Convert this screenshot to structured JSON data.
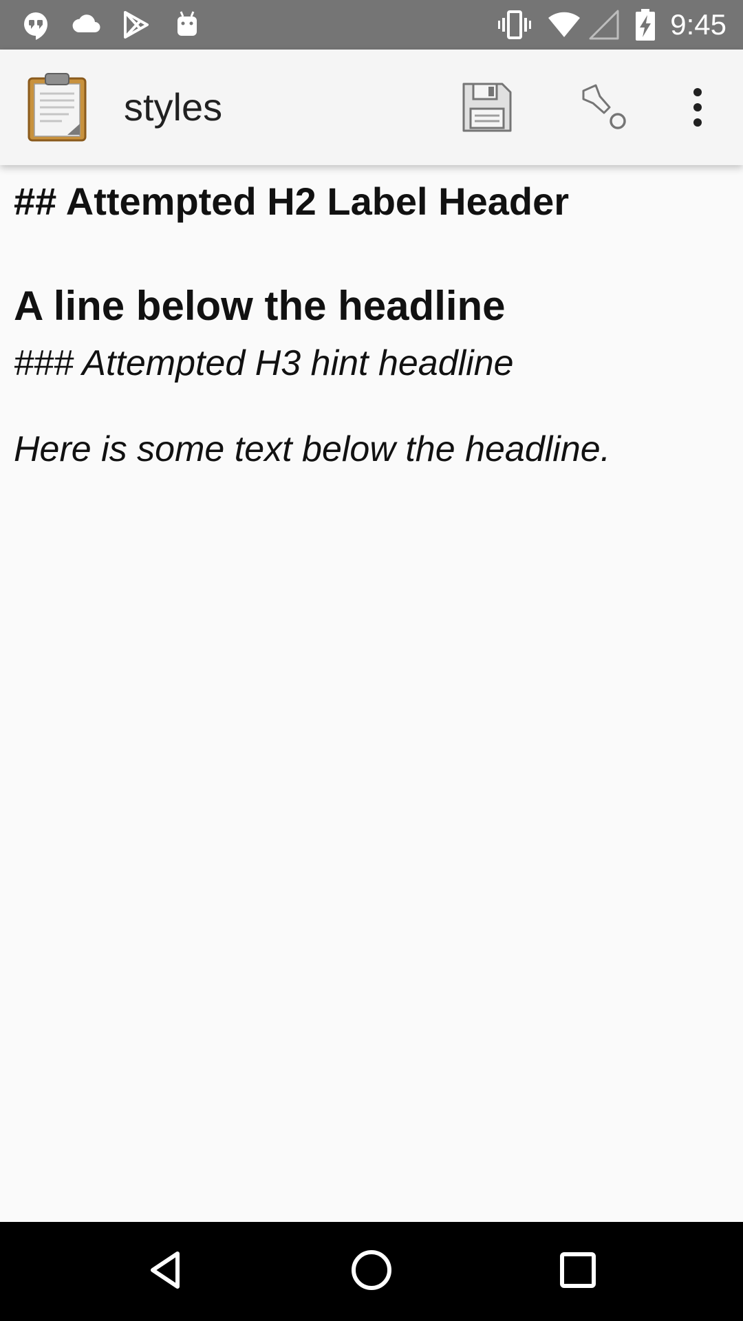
{
  "status_bar": {
    "time": "9:45",
    "left_icons": [
      "hangouts-icon",
      "cloud-icon",
      "play-store-icon",
      "android-icon"
    ],
    "right_icons": [
      "vibrate-icon",
      "wifi-icon",
      "cell-signal-icon",
      "battery-charging-icon"
    ],
    "background": "#757575"
  },
  "app_bar": {
    "title": "styles",
    "app_icon": "clipboard-icon",
    "actions": [
      "save-icon",
      "go-to-icon",
      "overflow-menu-icon"
    ],
    "background": "#f5f5f5"
  },
  "content": {
    "h2_raw": "## Attempted H2 Label Header",
    "label_line": "A line below the headline",
    "hint_line": "### Attempted H3 hint headline",
    "body_line": "Here is some text below the headline."
  },
  "nav_bar": {
    "buttons": [
      "back-icon",
      "home-icon",
      "recents-icon"
    ],
    "background": "#000000"
  }
}
